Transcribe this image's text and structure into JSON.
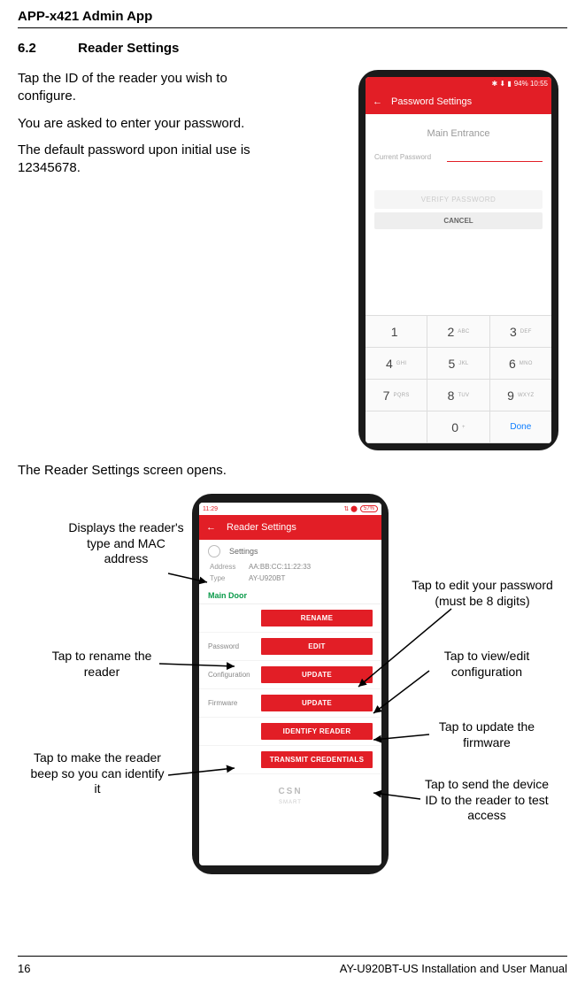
{
  "header": "APP-x421 Admin App",
  "section": {
    "num": "6.2",
    "title": "Reader Settings"
  },
  "para1": "Tap the ID of the reader you wish to configure.",
  "para2": "You are asked to enter your password.",
  "para3": "The default password upon initial use is 12345678.",
  "para4": "The Reader Settings screen opens.",
  "phone1": {
    "status_right": "94% 10:55",
    "title": "Password Settings",
    "main": "Main Entrance",
    "pwd_label": "Current Password",
    "verify": "VERIFY PASSWORD",
    "cancel": "CANCEL",
    "keys": [
      [
        "1",
        ""
      ],
      [
        "2",
        "ABC"
      ],
      [
        "3",
        "DEF"
      ],
      [
        "4",
        "GHI"
      ],
      [
        "5",
        "JKL"
      ],
      [
        "6",
        "MNO"
      ],
      [
        "7",
        "PQRS"
      ],
      [
        "8",
        "TUV"
      ],
      [
        "9",
        "WXYZ"
      ],
      [
        "",
        ""
      ],
      [
        "0",
        "+"
      ],
      [
        "Done",
        ""
      ]
    ]
  },
  "phone2": {
    "status_left": "11:29",
    "batt": "57%",
    "title": "Reader Settings",
    "settings": "Settings",
    "addr_lbl": "Address",
    "addr_val": "AA:BB:CC:11:22:33",
    "type_lbl": "Type",
    "type_val": "AY-U920BT",
    "door": "Main Door",
    "rows": {
      "rename": "RENAME",
      "password_lbl": "Password",
      "password_btn": "EDIT",
      "config_lbl": "Configuration",
      "config_btn": "UPDATE",
      "firmware_lbl": "Firmware",
      "firmware_btn": "UPDATE",
      "identify": "IDENTIFY READER",
      "transmit": "TRANSMIT CREDENTIALS"
    },
    "csn": "CSN",
    "csn_sub": "SMART"
  },
  "callouts": {
    "c1": "Displays the reader's type and MAC address",
    "c2": "Tap to rename the reader",
    "c3": "Tap to make the reader beep so you can identify it",
    "c4a": "Tap to edit your password",
    "c4b": "(must be 8 digits)",
    "c5": "Tap to view/edit configuration",
    "c6": "Tap to update the firmware",
    "c7": "Tap to send the device ID to the reader to test access"
  },
  "footer": {
    "page": "16",
    "doc": "AY-U920BT-US Installation and User Manual"
  }
}
